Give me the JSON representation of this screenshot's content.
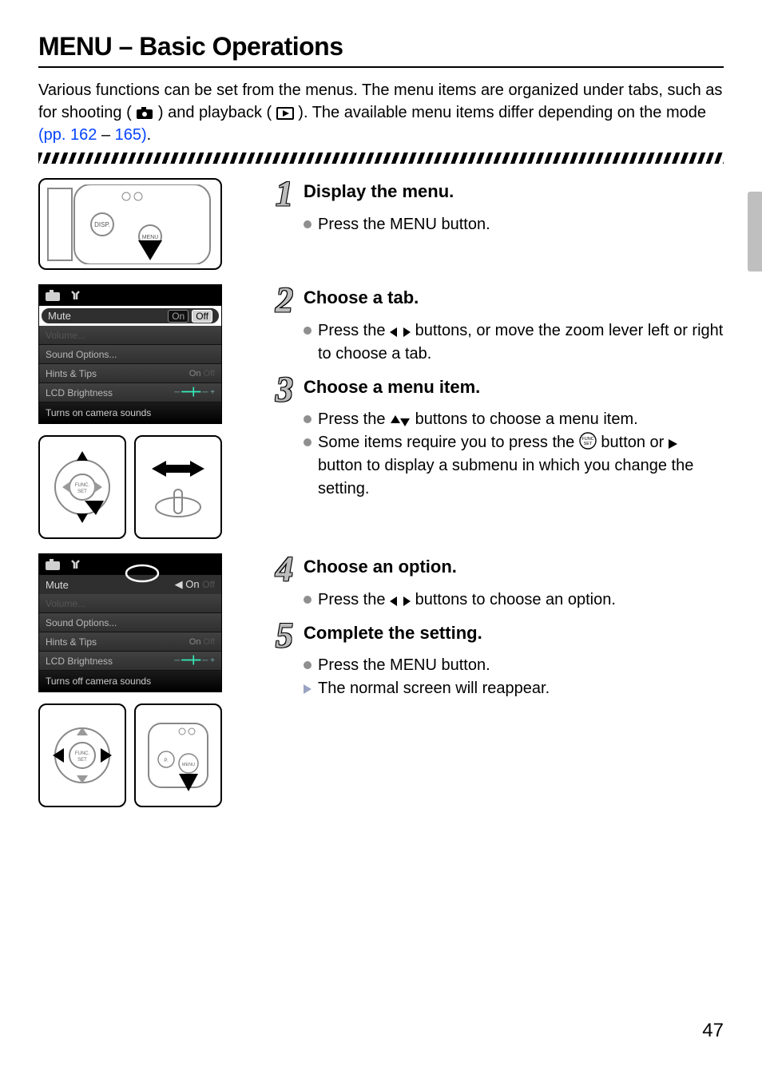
{
  "page_number": "47",
  "title": "MENU – Basic Operations",
  "intro_part1": "Various functions can be set from the menus. The menu items are organized under tabs, such as for shooting (",
  "intro_part2": ") and playback (",
  "intro_part3": "). The available menu items differ depending on the mode ",
  "intro_link1": "(pp. 162",
  "intro_dash": " – ",
  "intro_link2": "165)",
  "intro_tail": ".",
  "steps": {
    "s1": {
      "num": "1",
      "title": "Display the menu.",
      "b1a": "Press the ",
      "b1b": " button.",
      "menu_label": "MENU"
    },
    "s2": {
      "num": "2",
      "title": "Choose a tab.",
      "b1a": "Press the ",
      "b1b": " buttons, or move the zoom lever left or right to choose a tab."
    },
    "s3": {
      "num": "3",
      "title": "Choose a menu item.",
      "b1a": "Press the ",
      "b1b": " buttons to choose a menu item.",
      "b2a": "Some items require you to press the ",
      "b2b": " button or ",
      "b2c": " button to display a submenu in which you change the setting.",
      "func_label": "FUNC SET"
    },
    "s4": {
      "num": "4",
      "title": "Choose an option.",
      "b1a": "Press the ",
      "b1b": " buttons to choose an option."
    },
    "s5": {
      "num": "5",
      "title": "Complete the setting.",
      "b1a": "Press the ",
      "b1b": " button.",
      "b2": "The normal screen will reappear.",
      "menu_label": "MENU"
    }
  },
  "lcd_a": {
    "mute": "Mute",
    "mute_on": "On",
    "mute_off": "Off",
    "volume": "Volume...",
    "sound": "Sound Options...",
    "hints": "Hints & Tips",
    "hints_on": "On",
    "hints_off": "Off",
    "lcd": "LCD Brightness",
    "footer": "Turns on camera sounds"
  },
  "lcd_b": {
    "mute": "Mute",
    "mute_on": "On",
    "mute_off": "Off",
    "volume": "Volume...",
    "sound": "Sound Options...",
    "hints": "Hints & Tips",
    "hints_on": "On",
    "hints_off": "Off",
    "lcd": "LCD Brightness",
    "footer": "Turns off camera sounds"
  },
  "diagram_labels": {
    "disp": "DISP.",
    "menu": "MENU",
    "func": "FUNC. SET"
  }
}
